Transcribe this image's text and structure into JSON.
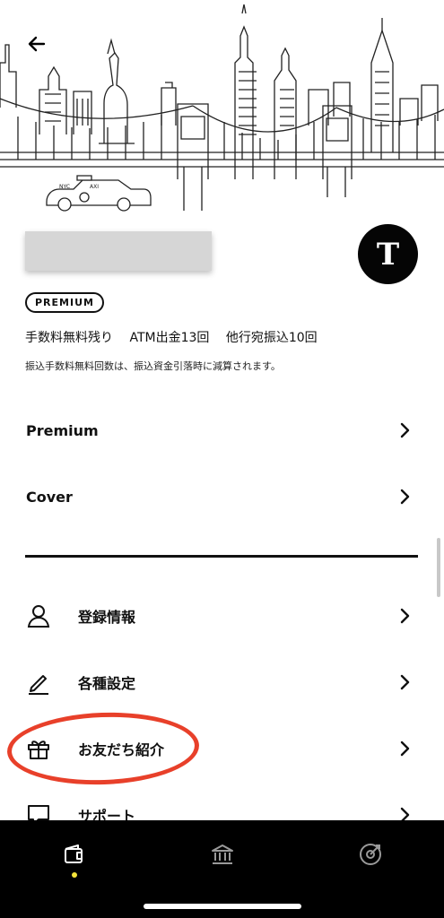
{
  "header": {
    "back_icon": "arrow-left-icon",
    "avatar_initial": "T",
    "badge": "PREMIUM"
  },
  "fees": {
    "items": [
      "手数料無料残り",
      "ATM出金13回",
      "他行宛振込10回"
    ],
    "note": "振込手数料無料回数は、振込資金引落時に減算されます。"
  },
  "menu_top": [
    {
      "label": "Premium"
    },
    {
      "label": "Cover"
    }
  ],
  "menu": [
    {
      "label": "登録情報",
      "icon": "person-icon"
    },
    {
      "label": "各種設定",
      "icon": "pencil-icon"
    },
    {
      "label": "お友だち紹介",
      "icon": "gift-icon"
    },
    {
      "label": "サポート",
      "icon": "chat-bubble-icon"
    }
  ],
  "tabbar": {
    "tabs": [
      {
        "icon": "wallet-icon",
        "active": true
      },
      {
        "icon": "bank-icon",
        "active": false
      },
      {
        "icon": "target-icon",
        "active": false
      }
    ]
  },
  "colors": {
    "highlight": "#e8402a",
    "active_dot": "#f4e33a",
    "tabbar_bg": "#000000"
  }
}
